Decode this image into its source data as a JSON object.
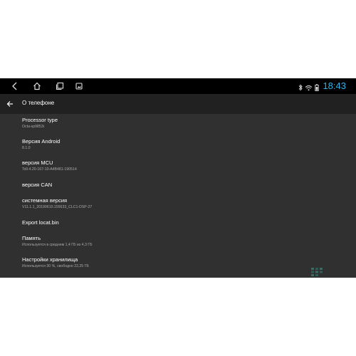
{
  "statusbar": {
    "time": "18:43",
    "icons": [
      "back-icon",
      "home-icon",
      "recents-icon",
      "screenshot-icon",
      "bluetooth-icon",
      "wifi-icon",
      "battery-icon"
    ],
    "accent": "#2fb3e8"
  },
  "toolbar": {
    "title": "О телефоне"
  },
  "items": [
    {
      "title": "Processor type",
      "subtitle": "Octa-sp9853i"
    },
    {
      "title": "Версия Android",
      "subtitle": "8.1.0"
    },
    {
      "title": "версия MCU",
      "subtitle": "Ts9.4.20-167-10-A4B481-190514"
    },
    {
      "title": "версия CAN",
      "subtitle": ""
    },
    {
      "title": "системная версия",
      "subtitle": "V11.1.1_20190610.155633_CLC1-DSP-27"
    },
    {
      "title": "Export locat.bin",
      "subtitle": ""
    },
    {
      "title": "Память",
      "subtitle": "Используется в среднем 1,4 ГБ из 4,3 ГБ"
    },
    {
      "title": "Настройки хранилища",
      "subtitle": "Используется 30 %, свободно 22,25 ГБ"
    }
  ]
}
